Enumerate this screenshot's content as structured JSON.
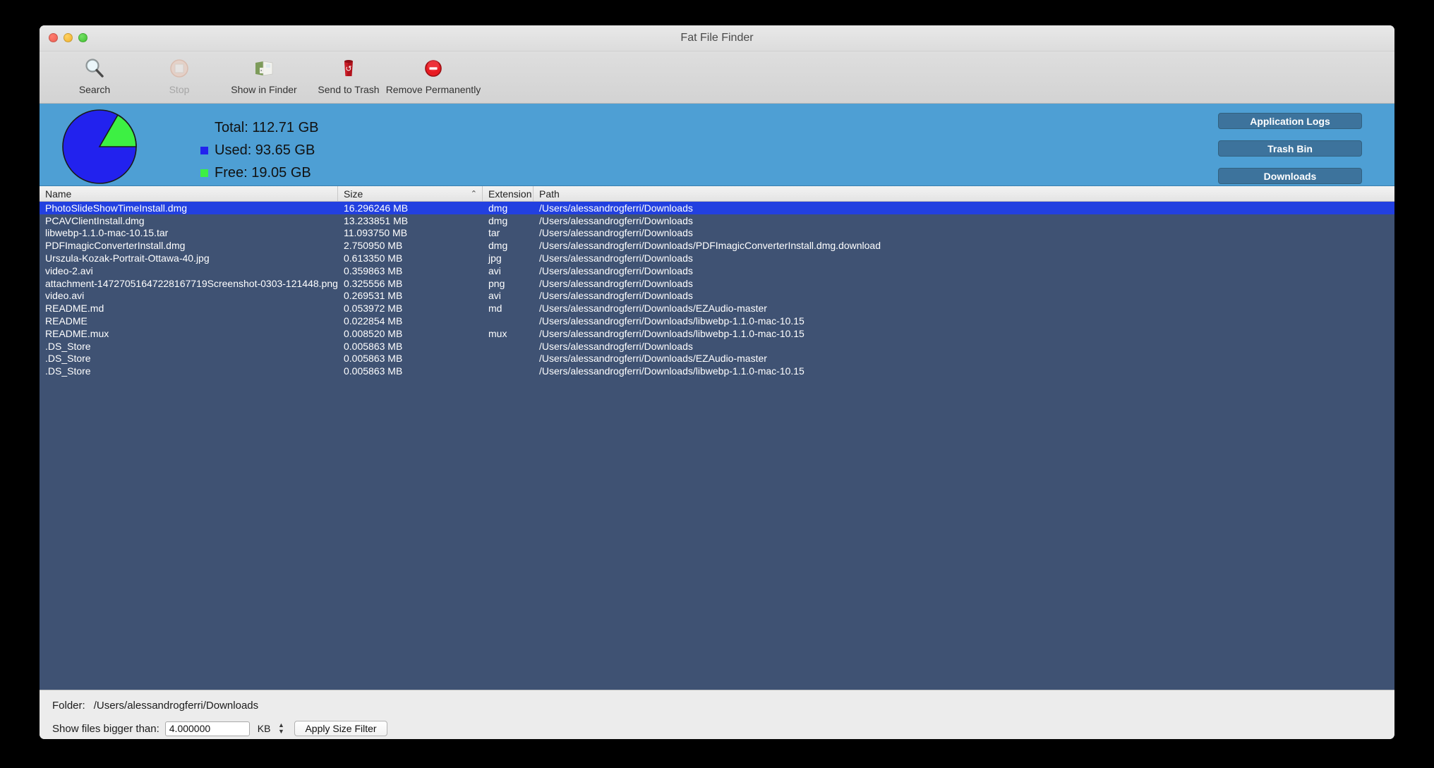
{
  "window": {
    "title": "Fat File Finder"
  },
  "toolbar": {
    "items": [
      {
        "label": "Search",
        "icon": "magnifier-icon",
        "disabled": false
      },
      {
        "label": "Stop",
        "icon": "stop-icon",
        "disabled": true
      },
      {
        "label": "Show in Finder",
        "icon": "finder-icon",
        "disabled": false
      },
      {
        "label": "Send to Trash",
        "icon": "trash-icon",
        "disabled": false
      },
      {
        "label": "Remove Permanently",
        "icon": "remove-icon",
        "disabled": false
      }
    ]
  },
  "summary": {
    "total_label": "Total: 112.71 GB",
    "used_label": "Used: 93.65 GB",
    "free_label": "Free: 19.05 GB",
    "colors": {
      "used": "#2222ee",
      "free": "#3df043",
      "panel": "#4e9fd4"
    },
    "buttons": [
      {
        "label": "Application Logs"
      },
      {
        "label": "Trash Bin"
      },
      {
        "label": "Downloads"
      }
    ]
  },
  "chart_data": {
    "type": "pie",
    "title": "Disk usage",
    "labels": [
      "Used",
      "Free"
    ],
    "values": [
      93.65,
      19.05
    ],
    "unit": "GB",
    "total": 112.71,
    "colors": [
      "#2222ee",
      "#3df043"
    ],
    "legend": "right"
  },
  "table": {
    "columns": [
      {
        "key": "name",
        "label": "Name",
        "sorted": false
      },
      {
        "key": "size",
        "label": "Size",
        "sorted": true,
        "sort_caret": "⌃"
      },
      {
        "key": "extension",
        "label": "Extension",
        "sorted": false
      },
      {
        "key": "path",
        "label": "Path",
        "sorted": false
      }
    ],
    "rows": [
      {
        "name": "PhotoSlideShowTimeInstall.dmg",
        "size": "16.296246 MB",
        "extension": "dmg",
        "path": "/Users/alessandrogferri/Downloads",
        "selected": true
      },
      {
        "name": "PCAVClientInstall.dmg",
        "size": "13.233851 MB",
        "extension": "dmg",
        "path": "/Users/alessandrogferri/Downloads",
        "selected": false
      },
      {
        "name": "libwebp-1.1.0-mac-10.15.tar",
        "size": "11.093750 MB",
        "extension": "tar",
        "path": "/Users/alessandrogferri/Downloads",
        "selected": false
      },
      {
        "name": "PDFImagicConverterInstall.dmg",
        "size": "2.750950 MB",
        "extension": "dmg",
        "path": "/Users/alessandrogferri/Downloads/PDFImagicConverterInstall.dmg.download",
        "selected": false
      },
      {
        "name": "Urszula-Kozak-Portrait-Ottawa-40.jpg",
        "size": "0.613350 MB",
        "extension": "jpg",
        "path": "/Users/alessandrogferri/Downloads",
        "selected": false
      },
      {
        "name": "video-2.avi",
        "size": "0.359863 MB",
        "extension": "avi",
        "path": "/Users/alessandrogferri/Downloads",
        "selected": false
      },
      {
        "name": "attachment-14727051647228167719Screenshot-0303-121448.png",
        "size": "0.325556 MB",
        "extension": "png",
        "path": "/Users/alessandrogferri/Downloads",
        "selected": false
      },
      {
        "name": "video.avi",
        "size": "0.269531 MB",
        "extension": "avi",
        "path": "/Users/alessandrogferri/Downloads",
        "selected": false
      },
      {
        "name": "README.md",
        "size": "0.053972 MB",
        "extension": "md",
        "path": "/Users/alessandrogferri/Downloads/EZAudio-master",
        "selected": false
      },
      {
        "name": "README",
        "size": "0.022854 MB",
        "extension": "",
        "path": "/Users/alessandrogferri/Downloads/libwebp-1.1.0-mac-10.15",
        "selected": false
      },
      {
        "name": "README.mux",
        "size": "0.008520 MB",
        "extension": "mux",
        "path": "/Users/alessandrogferri/Downloads/libwebp-1.1.0-mac-10.15",
        "selected": false
      },
      {
        "name": ".DS_Store",
        "size": "0.005863 MB",
        "extension": "",
        "path": "/Users/alessandrogferri/Downloads",
        "selected": false
      },
      {
        "name": ".DS_Store",
        "size": "0.005863 MB",
        "extension": "",
        "path": "/Users/alessandrogferri/Downloads/EZAudio-master",
        "selected": false
      },
      {
        "name": ".DS_Store",
        "size": "0.005863 MB",
        "extension": "",
        "path": "/Users/alessandrogferri/Downloads/libwebp-1.1.0-mac-10.15",
        "selected": false
      }
    ]
  },
  "footer": {
    "folder_label": "Folder:",
    "folder_value": "/Users/alessandrogferri/Downloads",
    "filter_label": "Show files bigger than:",
    "filter_value": "4.000000",
    "unit": "KB",
    "apply_label": "Apply Size Filter"
  }
}
